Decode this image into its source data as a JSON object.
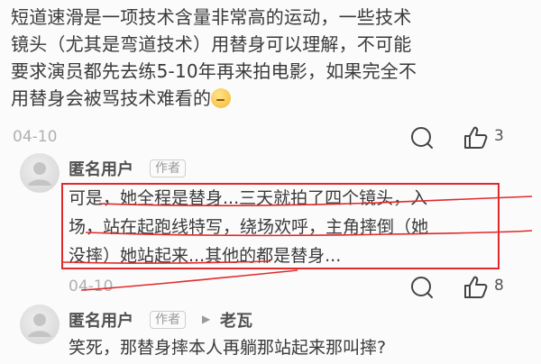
{
  "post": {
    "lines": [
      "短道速滑是一项技术含量非常高的运动，一些技术",
      "镜头（尤其是弯道技术）用替身可以理解，不可能",
      "要求演员都先去练5-10年再来拍电影，如果完全不",
      "用替身会被骂技术难看的"
    ],
    "emoji_icon": "thinking-face-emoji",
    "date": "04-10",
    "like_count": "3"
  },
  "comments": [
    {
      "author": "匿名用户",
      "badge": "作者",
      "lines": [
        "可是，她全程是替身...三天就拍了四个镜头，入",
        "场，站在起跑线特写，绕场欢呼，主角摔倒（她",
        "没摔）她站起来...其他的都是替身..."
      ],
      "date": "04-10",
      "like_count": "8"
    },
    {
      "author": "匿名用户",
      "badge": "作者",
      "reply_arrow": "▶",
      "reply_to": "老瓦",
      "lines": [
        "笑死，那替身摔本人再躺那站起来那叫摔?"
      ]
    }
  ],
  "icons": {
    "comment": "comment-bubble-icon",
    "like": "thumbs-up-icon",
    "avatar": "default-avatar-icon"
  },
  "colors": {
    "annotation_red": "#e02a2a",
    "muted_text": "#b0b0b0",
    "body_text": "#3a3a3a"
  }
}
